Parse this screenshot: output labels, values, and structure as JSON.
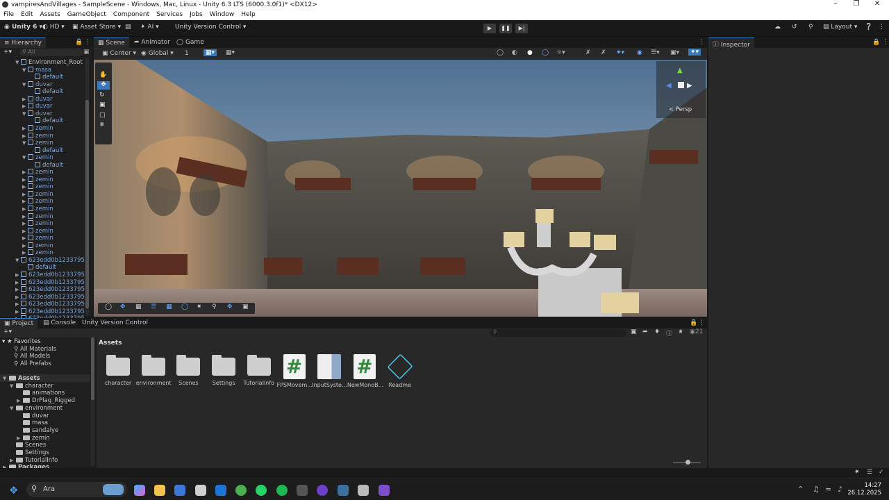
{
  "window": {
    "title": "vampiresAndVillages - SampleScene - Windows, Mac, Linux - Unity 6.3 LTS (6000.3.0f1)* <DX12>"
  },
  "menu": [
    "File",
    "Edit",
    "Assets",
    "GameObject",
    "Component",
    "Services",
    "Jobs",
    "Window",
    "Help"
  ],
  "toolbar": {
    "account": "Unity 6",
    "hd": "HD",
    "asset_store": "Asset Store",
    "ai": "AI",
    "version_control": "Unity Version Control",
    "layout": "Layout"
  },
  "hierarchy": {
    "tab": "Hierarchy",
    "search_placeholder": "All",
    "rows": [
      {
        "label": "Environment_Root",
        "depth": 1,
        "kind": "root"
      },
      {
        "label": "masa",
        "depth": 2,
        "kind": "obj"
      },
      {
        "label": "default",
        "depth": 3,
        "kind": "child"
      },
      {
        "label": "duvar",
        "depth": 2,
        "kind": "obj"
      },
      {
        "label": "default",
        "depth": 3,
        "kind": "child"
      },
      {
        "label": "duvar",
        "depth": 2,
        "kind": "obj"
      },
      {
        "label": "duvar",
        "depth": 2,
        "kind": "obj"
      },
      {
        "label": "duvar",
        "depth": 2,
        "kind": "obj"
      },
      {
        "label": "default",
        "depth": 3,
        "kind": "child"
      },
      {
        "label": "zemin",
        "depth": 2,
        "kind": "obj"
      },
      {
        "label": "zemin",
        "depth": 2,
        "kind": "obj"
      },
      {
        "label": "zemin",
        "depth": 2,
        "kind": "obj"
      },
      {
        "label": "default",
        "depth": 3,
        "kind": "child"
      },
      {
        "label": "zemin",
        "depth": 2,
        "kind": "obj"
      },
      {
        "label": "default",
        "depth": 3,
        "kind": "child"
      },
      {
        "label": "zemin",
        "depth": 2,
        "kind": "obj"
      },
      {
        "label": "zemin",
        "depth": 2,
        "kind": "obj"
      },
      {
        "label": "zemin",
        "depth": 2,
        "kind": "obj"
      },
      {
        "label": "zemin",
        "depth": 2,
        "kind": "obj"
      },
      {
        "label": "zemin",
        "depth": 2,
        "kind": "obj"
      },
      {
        "label": "zemin",
        "depth": 2,
        "kind": "obj"
      },
      {
        "label": "zemin",
        "depth": 2,
        "kind": "obj"
      },
      {
        "label": "zemin",
        "depth": 2,
        "kind": "obj"
      },
      {
        "label": "zemin",
        "depth": 2,
        "kind": "obj"
      },
      {
        "label": "zemin",
        "depth": 2,
        "kind": "obj"
      },
      {
        "label": "zemin",
        "depth": 2,
        "kind": "obj"
      },
      {
        "label": "zemin",
        "depth": 2,
        "kind": "obj"
      },
      {
        "label": "623edd0b1233795",
        "depth": 1,
        "kind": "obj"
      },
      {
        "label": "default",
        "depth": 2,
        "kind": "child"
      },
      {
        "label": "623edd0b1233795",
        "depth": 1,
        "kind": "obj"
      },
      {
        "label": "623edd0b1233795",
        "depth": 1,
        "kind": "obj"
      },
      {
        "label": "623edd0b1233795",
        "depth": 1,
        "kind": "obj"
      },
      {
        "label": "623edd0b1233795",
        "depth": 1,
        "kind": "obj"
      },
      {
        "label": "623edd0b1233795",
        "depth": 1,
        "kind": "obj"
      },
      {
        "label": "623edd0b1233795",
        "depth": 1,
        "kind": "obj"
      },
      {
        "label": "623edd0b1233795",
        "depth": 1,
        "kind": "obj"
      }
    ]
  },
  "scene_tabs": [
    "Scene",
    "Animator",
    "Game"
  ],
  "scene_toolbar": {
    "pivot": "Center",
    "space": "Global",
    "grid_value": "1"
  },
  "gizmo": {
    "persp": "< Persp"
  },
  "inspector": {
    "tab": "Inspector"
  },
  "bottom_tabs": [
    "Project",
    "Console",
    "Unity Version Control"
  ],
  "project": {
    "favorites": [
      "Favorites",
      "All Materials",
      "All Models",
      "All Prefabs"
    ],
    "tree": [
      {
        "label": "Assets",
        "depth": 0
      },
      {
        "label": "character",
        "depth": 1
      },
      {
        "label": "animations",
        "depth": 2
      },
      {
        "label": "DrPlag_Rigged",
        "depth": 2
      },
      {
        "label": "environment",
        "depth": 1
      },
      {
        "label": "duvar",
        "depth": 2
      },
      {
        "label": "masa",
        "depth": 2
      },
      {
        "label": "sandalye",
        "depth": 2
      },
      {
        "label": "zemin",
        "depth": 2
      },
      {
        "label": "Scenes",
        "depth": 1
      },
      {
        "label": "Settings",
        "depth": 1
      },
      {
        "label": "TutorialInfo",
        "depth": 1
      },
      {
        "label": "Packages",
        "depth": 0
      }
    ],
    "breadcrumb": "Assets",
    "hidden_count": "21",
    "assets": [
      {
        "label": "character",
        "type": "folder"
      },
      {
        "label": "environment",
        "type": "folder"
      },
      {
        "label": "Scenes",
        "type": "folder"
      },
      {
        "label": "Settings",
        "type": "folder"
      },
      {
        "label": "TutorialInfo",
        "type": "folder"
      },
      {
        "label": "FPSMovem...",
        "type": "script"
      },
      {
        "label": "InputSyste...",
        "type": "input"
      },
      {
        "label": "NewMonoB...",
        "type": "script"
      },
      {
        "label": "Readme",
        "type": "readme"
      }
    ]
  },
  "taskbar": {
    "search": "Ara",
    "time": "14:27",
    "date": "26.12.2025"
  }
}
